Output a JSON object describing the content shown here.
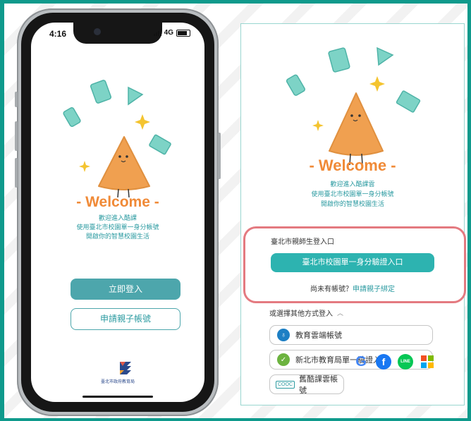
{
  "phone": {
    "status_time": "4:16",
    "status_network": "4G",
    "welcome": "- Welcome -",
    "sub_lines": [
      "歡迎進入酷課",
      "使用臺北市校園單一身分帳號",
      "開啟你的智慧校園生活"
    ],
    "login_button": "立即登入",
    "apply_button": "申請親子帳號",
    "logo_text": "臺北市政府教育局"
  },
  "panel": {
    "welcome": "- Welcome -",
    "sub_lines": [
      "歡迎進入酷課雲",
      "使用臺北市校園單一身分帳號",
      "開啟你的智慧校園生活"
    ],
    "teacher_student_label": "臺北市親師生登入口",
    "sso_button": "臺北市校園單一身分驗證入口",
    "no_account": "尚未有帳號？",
    "apply_link": "申請親子綁定",
    "other_login": "或選擇其他方式登入",
    "options": [
      {
        "label": "教育雲端帳號"
      },
      {
        "label": "新北市教育局單一驗證入口"
      },
      {
        "label": "舊酷課雲帳號",
        "badge": "COOC"
      }
    ]
  },
  "colors": {
    "background": "#0f9a8c",
    "accent_teal": "#4da6ac",
    "welcome_orange": "#f08a37",
    "highlight_red": "#e47a80",
    "mascot": "#f0a050"
  }
}
